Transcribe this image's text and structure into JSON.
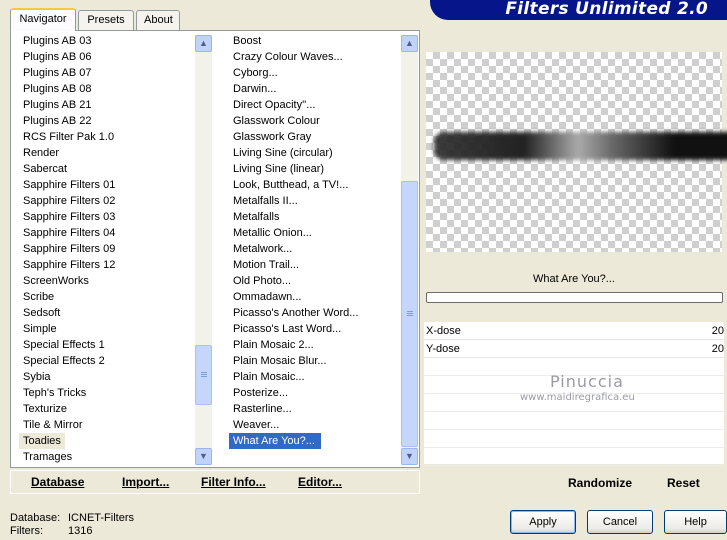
{
  "tabs": [
    {
      "label": "Navigator",
      "active": true
    },
    {
      "label": "Presets",
      "active": false
    },
    {
      "label": "About",
      "active": false
    }
  ],
  "banner": {
    "title": "Filters Unlimited 2.0",
    "color": "#06168a"
  },
  "categories": [
    "Plugins AB 03",
    "Plugins AB 06",
    "Plugins AB 07",
    "Plugins AB 08",
    "Plugins AB 21",
    "Plugins AB 22",
    "RCS Filter Pak 1.0",
    "Render",
    "Sabercat",
    "Sapphire Filters 01",
    "Sapphire Filters 02",
    "Sapphire Filters 03",
    "Sapphire Filters 04",
    "Sapphire Filters 09",
    "Sapphire Filters 12",
    "ScreenWorks",
    "Scribe",
    "Sedsoft",
    "Simple",
    "Special Effects 1",
    "Special Effects 2",
    "Sybia",
    "Teph's Tricks",
    "Texturize",
    "Tile & Mirror",
    "Toadies",
    "Tramages"
  ],
  "selected_category": "Toadies",
  "filters": [
    "Boost",
    "Crazy Colour Waves...",
    "Cyborg...",
    "Darwin...",
    "Direct Opacity''...",
    "Glasswork Colour",
    "Glasswork Gray",
    "Living Sine (circular)",
    "Living Sine (linear)",
    "Look, Butthead, a TV!...",
    "Metalfalls II...",
    "Metalfalls",
    "Metallic Onion...",
    "Metalwork...",
    "Motion Trail...",
    "Old Photo...",
    "Ommadawn...",
    "Picasso's Another Word...",
    "Picasso's Last Word...",
    "Plain Mosaic 2...",
    "Plain Mosaic Blur...",
    "Plain Mosaic...",
    "Posterize...",
    "Rasterline...",
    "Weaver...",
    "What Are You?..."
  ],
  "selected_filter": "What Are You?...",
  "toolbar": {
    "database": "Database",
    "import": "Import...",
    "filter_info": "Filter Info...",
    "editor": "Editor..."
  },
  "filter_title": "What Are You?...",
  "params": [
    {
      "label": "X-dose",
      "value": "20"
    },
    {
      "label": "Y-dose",
      "value": "20"
    }
  ],
  "watermark": {
    "name": "Pinuccia",
    "url": "www.maidiregrafica.eu"
  },
  "right_toolbar": {
    "randomize": "Randomize",
    "reset": "Reset"
  },
  "status": {
    "database_label": "Database:",
    "database_value": "ICNET-Filters",
    "filters_label": "Filters:",
    "filters_value": "1316"
  },
  "buttons": {
    "apply": "Apply",
    "cancel": "Cancel",
    "help": "Help"
  },
  "colors": {
    "selection": "#316ac5",
    "accent": "#ffc83c"
  }
}
